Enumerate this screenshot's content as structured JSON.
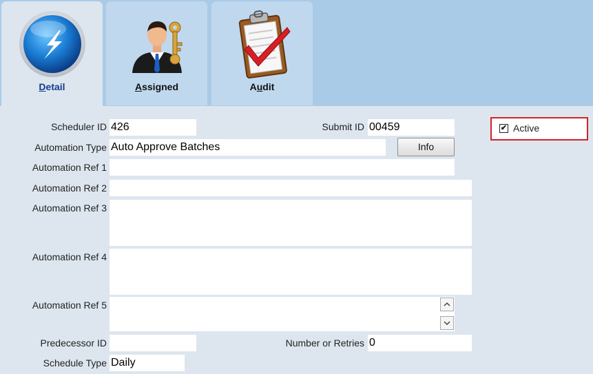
{
  "tabs": [
    {
      "label_prefix": "",
      "label_underline": "D",
      "label_rest": "etail",
      "icon": "lightning-orb-icon",
      "active": true
    },
    {
      "label_prefix": "",
      "label_underline": "A",
      "label_rest": "ssigned",
      "icon": "user-key-icon",
      "active": false
    },
    {
      "label_prefix": "A",
      "label_underline": "u",
      "label_rest": "dit",
      "icon": "clipboard-check-icon",
      "active": false
    }
  ],
  "form": {
    "scheduler_id": {
      "label": "Scheduler ID",
      "value": "426"
    },
    "submit_id": {
      "label": "Submit ID",
      "value": "00459"
    },
    "automation_type": {
      "label": "Automation Type",
      "value": "Auto Approve Batches"
    },
    "info_button": "Info",
    "automation_ref_1": {
      "label": "Automation Ref 1",
      "value": ""
    },
    "automation_ref_2": {
      "label": "Automation Ref 2",
      "value": ""
    },
    "automation_ref_3": {
      "label": "Automation Ref 3",
      "value": ""
    },
    "automation_ref_4": {
      "label": "Automation Ref 4",
      "value": ""
    },
    "automation_ref_5": {
      "label": "Automation Ref 5",
      "value": ""
    },
    "predecessor_id": {
      "label": "Predecessor ID",
      "value": ""
    },
    "number_of_retries": {
      "label": "Number or Retries",
      "value": "0"
    },
    "schedule_type": {
      "label": "Schedule Type",
      "value": "Daily"
    },
    "active": {
      "label": "Active",
      "checked": true,
      "check_glyph": "✔"
    }
  },
  "colors": {
    "highlight_border": "#d42025",
    "tab_bar": "#a9cbe8",
    "form_bg": "#dde6ef"
  }
}
